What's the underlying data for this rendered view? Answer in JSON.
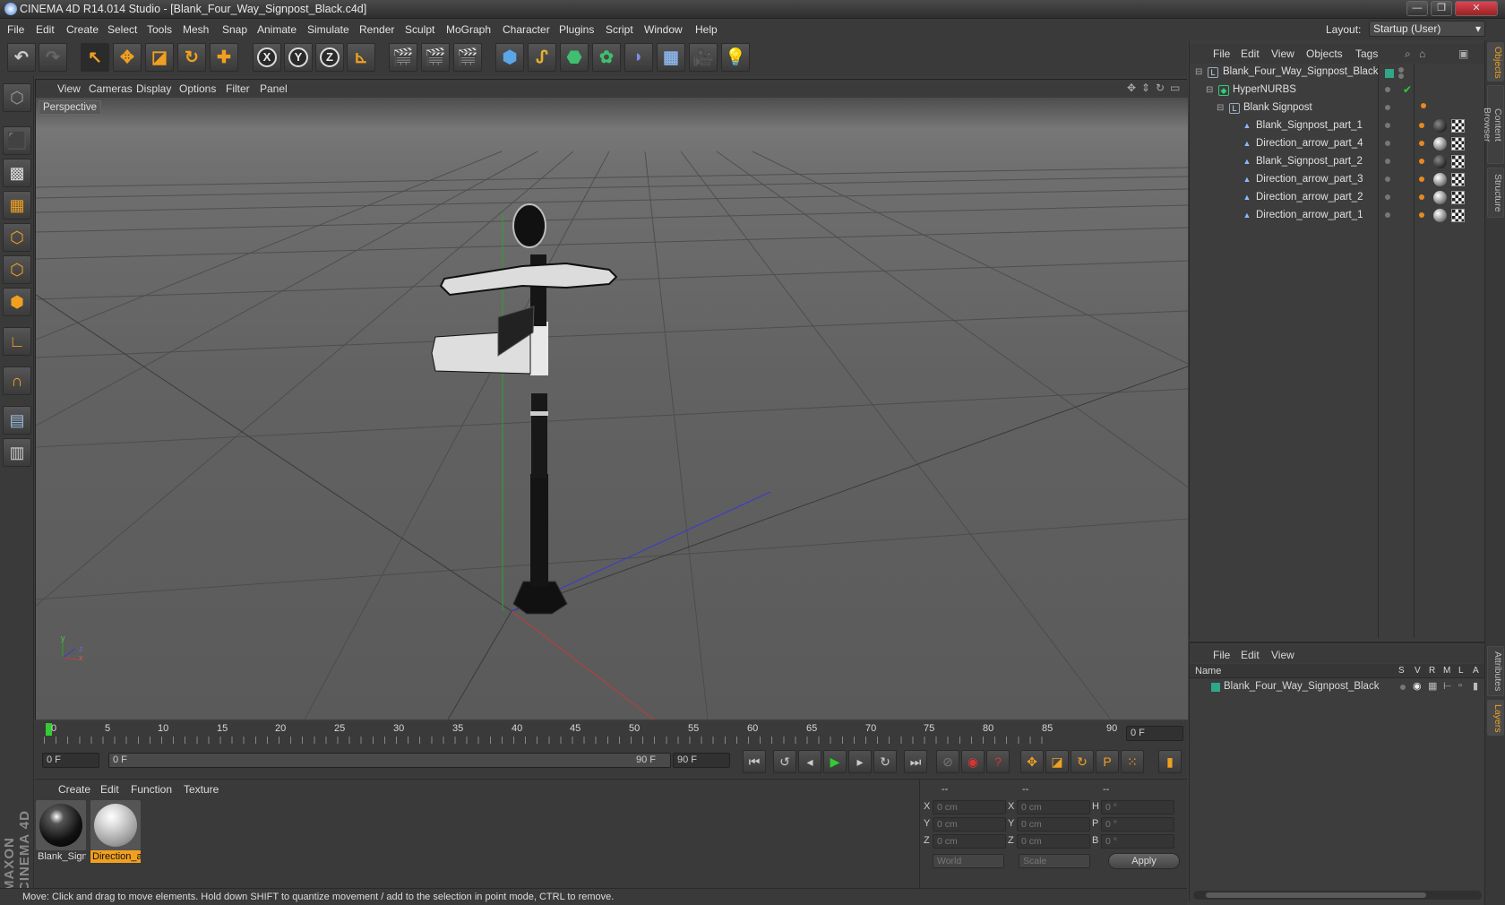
{
  "window": {
    "title": "CINEMA 4D R14.014 Studio - [Blank_Four_Way_Signpost_Black.c4d]",
    "controls": [
      "—",
      "❐",
      "✕"
    ]
  },
  "menubar": {
    "items": [
      "File",
      "Edit",
      "Create",
      "Select",
      "Tools",
      "Mesh",
      "Snap",
      "Animate",
      "Simulate",
      "Render",
      "Sculpt",
      "MoGraph",
      "Character",
      "Plugins",
      "Script",
      "Window",
      "Help"
    ],
    "layout_label": "Layout:",
    "layout_value": "Startup (User)"
  },
  "viewport": {
    "menu": [
      "View",
      "Cameras",
      "Display",
      "Options",
      "Filter",
      "Panel"
    ],
    "camera_label": "Perspective",
    "axis_labels": {
      "x": "x",
      "y": "y",
      "z": "z"
    }
  },
  "timeline": {
    "ticks": [
      "0",
      "5",
      "10",
      "15",
      "20",
      "25",
      "30",
      "35",
      "40",
      "45",
      "50",
      "55",
      "60",
      "65",
      "70",
      "75",
      "80",
      "85",
      "90"
    ],
    "current_frame": "0 F",
    "start_field": "0 F",
    "range_start": "0 F",
    "range_end": "90 F",
    "end_field": "90 F"
  },
  "materials": {
    "menu": [
      "Create",
      "Edit",
      "Function",
      "Texture"
    ],
    "items": [
      {
        "label": "Blank_Sign",
        "selected": false
      },
      {
        "label": "Direction_a",
        "selected": true
      }
    ]
  },
  "coordinates": {
    "headers": [
      "--",
      "--",
      "--"
    ],
    "rows": [
      {
        "a": "X",
        "av": "0 cm",
        "b": "X",
        "bv": "0 cm",
        "c": "H",
        "cv": "0 °"
      },
      {
        "a": "Y",
        "av": "0 cm",
        "b": "Y",
        "bv": "0 cm",
        "c": "P",
        "cv": "0 °"
      },
      {
        "a": "Z",
        "av": "0 cm",
        "b": "Z",
        "bv": "0 cm",
        "c": "B",
        "cv": "0 °"
      }
    ],
    "space": "World",
    "mode": "Scale",
    "apply": "Apply"
  },
  "objects": {
    "menu": [
      "File",
      "Edit",
      "View",
      "Objects",
      "Tags"
    ],
    "tree": [
      {
        "name": "Blank_Four_Way_Signpost_Black",
        "depth": 0,
        "icon": "null"
      },
      {
        "name": "HyperNURBS",
        "depth": 1,
        "icon": "nurbs"
      },
      {
        "name": "Blank Signpost",
        "depth": 2,
        "icon": "null"
      },
      {
        "name": "Blank_Signpost_part_1",
        "depth": 3,
        "icon": "poly"
      },
      {
        "name": "Direction_arrow_part_4",
        "depth": 3,
        "icon": "poly"
      },
      {
        "name": "Blank_Signpost_part_2",
        "depth": 3,
        "icon": "poly"
      },
      {
        "name": "Direction_arrow_part_3",
        "depth": 3,
        "icon": "poly"
      },
      {
        "name": "Direction_arrow_part_2",
        "depth": 3,
        "icon": "poly"
      },
      {
        "name": "Direction_arrow_part_1",
        "depth": 3,
        "icon": "poly"
      }
    ]
  },
  "layers": {
    "menu": [
      "File",
      "Edit",
      "View"
    ],
    "columns": {
      "name": "Name",
      "flags": [
        "S",
        "V",
        "R",
        "M",
        "L",
        "A"
      ]
    },
    "rows": [
      {
        "name": "Blank_Four_Way_Signpost_Black",
        "color": "#2fa88a"
      }
    ]
  },
  "side_tabs": [
    "Objects",
    "Content Browser",
    "Structure",
    "Attributes",
    "Layers"
  ],
  "status": "Move: Click and drag to move elements. Hold down SHIFT to quantize movement / add to the selection in point mode, CTRL to remove.",
  "brand": "MAXON CINEMA 4D",
  "colors": {
    "accent": "#f0a020",
    "ui_bg": "#3d3d3d",
    "selection": "#f0a020"
  }
}
